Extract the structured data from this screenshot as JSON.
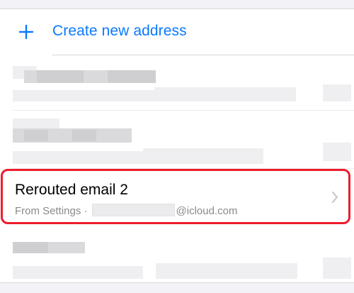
{
  "create_row": {
    "label": "Create new address",
    "icon": "plus-icon",
    "accent_color": "#0a7aff"
  },
  "highlighted_item": {
    "title": "Rerouted email 2",
    "subtitle_prefix": "From Settings ·",
    "subtitle_domain": "@icloud.com",
    "chevron_icon": "chevron-right-icon",
    "highlight_color": "#ee1c2b"
  }
}
